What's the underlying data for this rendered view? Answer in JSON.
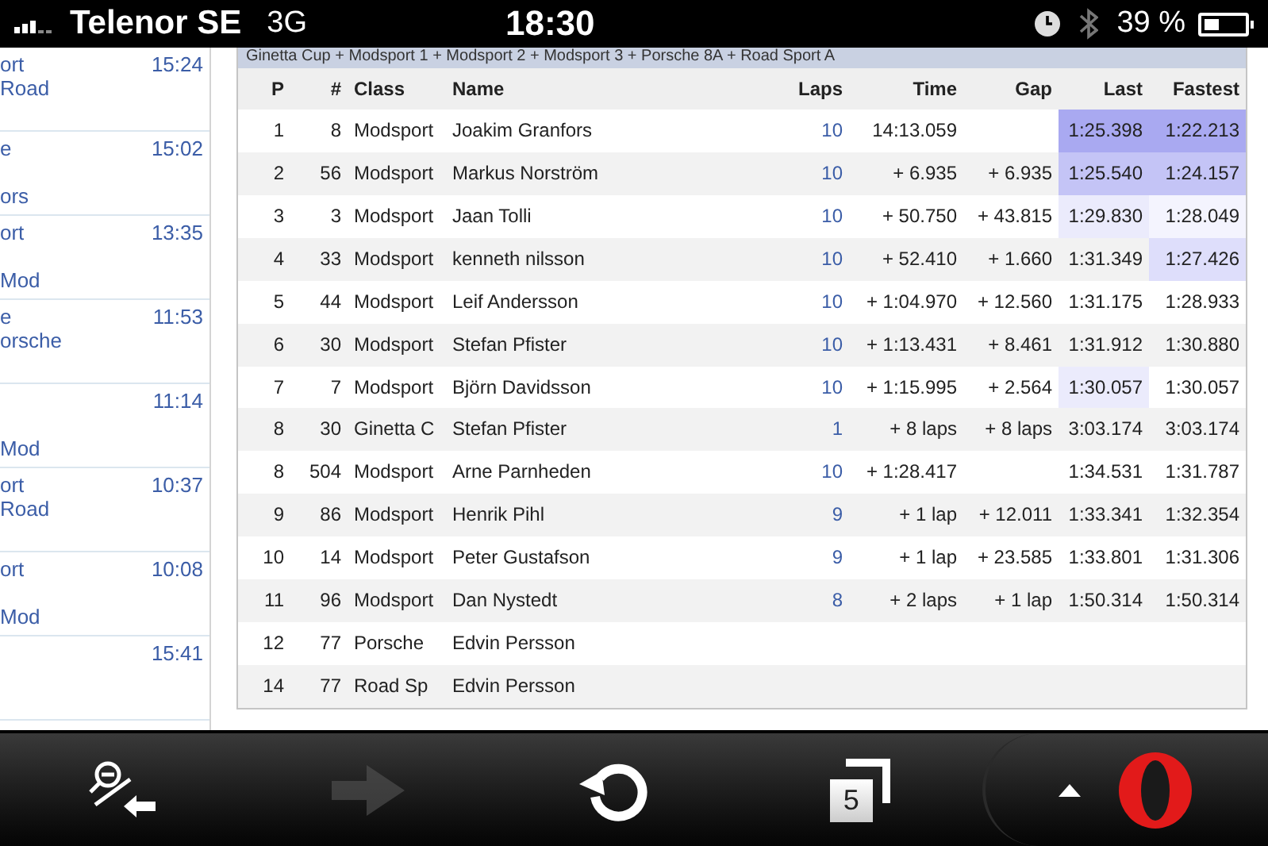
{
  "status_bar": {
    "carrier": "Telenor SE",
    "network": "3G",
    "time": "18:30",
    "battery": "39 %"
  },
  "sidebar": {
    "items": [
      {
        "kind": "adjacent",
        "lines": [
          "ort",
          "Road"
        ],
        "time": "15:24"
      },
      {
        "kind": "spaced",
        "lines": [
          "e",
          "ors"
        ],
        "time": "15:02"
      },
      {
        "kind": "spaced",
        "lines": [
          "ort",
          "Mod"
        ],
        "time": "13:35"
      },
      {
        "kind": "adjacent",
        "lines": [
          "e",
          "orsche"
        ],
        "time": "11:53"
      },
      {
        "kind": "spaced",
        "lines": [
          "Mod"
        ],
        "time": "11:14"
      },
      {
        "kind": "adjacent",
        "lines": [
          "ort",
          "Road"
        ],
        "time": "10:37"
      },
      {
        "kind": "spaced",
        "lines": [
          "ort",
          "Mod"
        ],
        "time": "10:08"
      },
      {
        "kind": "adjacent",
        "time": "15:41"
      }
    ]
  },
  "table": {
    "caption": "Ginetta Cup + Modsport 1 + Modsport 2 + Modsport 3 + Porsche 8A + Road Sport A",
    "columns": [
      "P",
      "#",
      "Class",
      "Name",
      "Laps",
      "Time",
      "Gap",
      "Last",
      "Fastest"
    ],
    "rows": [
      {
        "p": "1",
        "num": "8",
        "class": "Modsport",
        "name": "Joakim Granfors",
        "laps": "10",
        "time": "14:13.059",
        "last": {
          "text": "1:25.398",
          "color": "#a9a9f1"
        },
        "fastest": {
          "text": "1:22.213",
          "color": "#a9a9f1"
        }
      },
      {
        "p": "2",
        "num": "56",
        "class": "Modsport",
        "name": "Markus Norström",
        "laps": "10",
        "time": "+ 6.935",
        "gap": "+ 6.935",
        "last": {
          "text": "1:25.540",
          "color": "#c4c4f6"
        },
        "fastest": {
          "text": "1:24.157",
          "color": "#c4c4f6"
        }
      },
      {
        "p": "3",
        "num": "3",
        "class": "Modsport",
        "name": "Jaan Tolli",
        "laps": "10",
        "time": "+ 50.750",
        "gap": "+ 43.815",
        "last": {
          "text": "1:29.830",
          "color": "#ebebfc"
        },
        "fastest": {
          "text": "1:28.049",
          "color": "#f4f4fe"
        }
      },
      {
        "p": "4",
        "num": "33",
        "class": "Modsport",
        "name": "kenneth nilsson",
        "laps": "10",
        "time": "+ 52.410",
        "gap": "+ 1.660",
        "last": {
          "text": "1:31.349"
        },
        "fastest": {
          "text": "1:27.426",
          "color": "#dedefb"
        }
      },
      {
        "p": "5",
        "num": "44",
        "class": "Modsport",
        "name": "Leif Andersson",
        "laps": "10",
        "time": "+ 1:04.970",
        "gap": "+ 12.560",
        "last": {
          "text": "1:31.175"
        },
        "fastest": {
          "text": "1:28.933"
        }
      },
      {
        "p": "6",
        "num": "30",
        "class": "Modsport",
        "name": "Stefan Pfister",
        "laps": "10",
        "time": "+ 1:13.431",
        "gap": "+ 8.461",
        "last": {
          "text": "1:31.912"
        },
        "fastest": {
          "text": "1:30.880"
        }
      },
      {
        "p": "7",
        "num": "7",
        "class": "Modsport",
        "name": "Björn Davidsson",
        "laps": "10",
        "time": "+ 1:15.995",
        "gap": "+ 2.564",
        "last": {
          "text": "1:30.057",
          "color": "#ebebfc"
        },
        "fastest": {
          "text": "1:30.057"
        }
      },
      {
        "p": "8",
        "num": "30",
        "class": "Ginetta C",
        "name": "Stefan Pfister",
        "laps": "1",
        "time": "+ 8 laps",
        "gap": "+ 8 laps",
        "last": {
          "text": "3:03.174"
        },
        "fastest": {
          "text": "3:03.174"
        }
      },
      {
        "p": "8",
        "num": "504",
        "class": "Modsport",
        "name": "Arne Parnheden",
        "laps": "10",
        "time": "+ 1:28.417",
        "last": {
          "text": "1:34.531"
        },
        "fastest": {
          "text": "1:31.787"
        }
      },
      {
        "p": "9",
        "num": "86",
        "class": "Modsport",
        "name": "Henrik Pihl",
        "laps": "9",
        "time": "+ 1 lap",
        "gap": "+ 12.011",
        "last": {
          "text": "1:33.341"
        },
        "fastest": {
          "text": "1:32.354"
        }
      },
      {
        "p": "10",
        "num": "14",
        "class": "Modsport",
        "name": "Peter Gustafson",
        "laps": "9",
        "time": "+ 1 lap",
        "gap": "+ 23.585",
        "last": {
          "text": "1:33.801"
        },
        "fastest": {
          "text": "1:31.306"
        }
      },
      {
        "p": "11",
        "num": "96",
        "class": "Modsport",
        "name": "Dan Nystedt",
        "laps": "8",
        "time": "+ 2 laps",
        "gap": "+ 1 lap",
        "last": {
          "text": "1:50.314"
        },
        "fastest": {
          "text": "1:50.314"
        }
      },
      {
        "p": "12",
        "num": "77",
        "class": "Porsche",
        "name": "Edvin Persson"
      },
      {
        "p": "14",
        "num": "77",
        "class": "Road Sp",
        "name": "Edvin Persson"
      }
    ]
  },
  "toolbar": {
    "buttons": [
      {
        "kind": "zoom_back",
        "disabled": false
      },
      {
        "kind": "forward",
        "disabled": true
      },
      {
        "kind": "reload",
        "disabled": false
      },
      {
        "kind": "tabs",
        "count": "5",
        "disabled": false
      },
      {
        "kind": "menu",
        "disabled": false
      }
    ]
  }
}
